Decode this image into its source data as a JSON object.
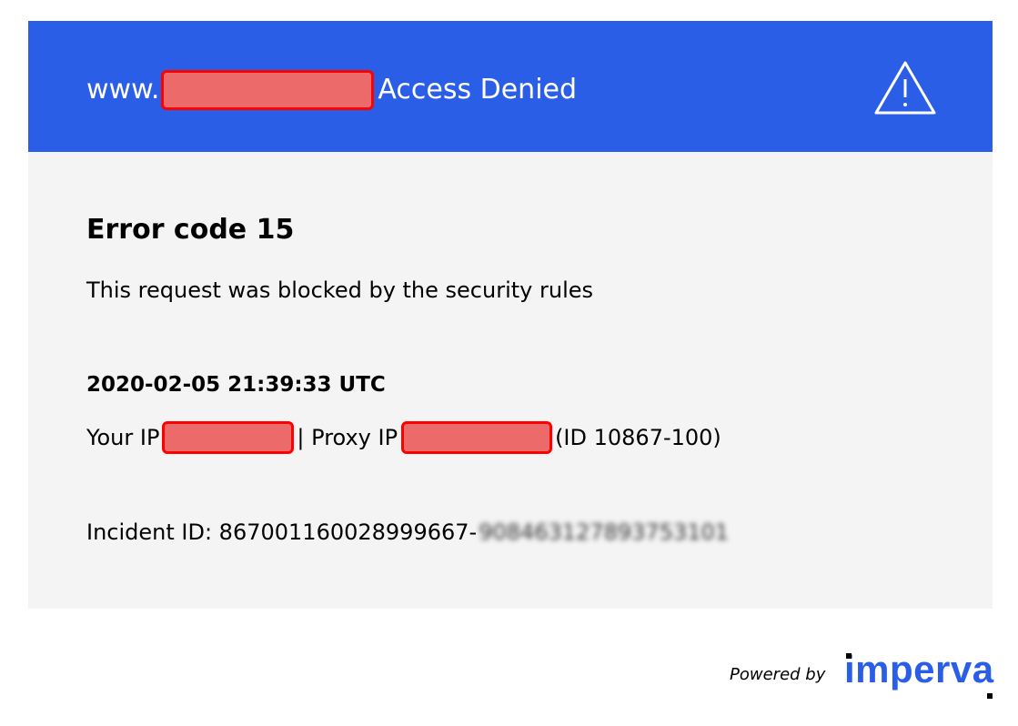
{
  "header": {
    "prefix": "www.",
    "title": "Access Denied",
    "icon": "warning-triangle-icon",
    "background_color": "#2a5ee6"
  },
  "error": {
    "code_title": "Error code 15",
    "message": "This request was blocked by the security rules"
  },
  "details": {
    "timestamp": "2020-02-05 21:39:33 UTC",
    "your_ip_label": "Your IP",
    "separator": "| Proxy IP",
    "id_text": "(ID 10867-100)",
    "incident_label": "Incident ID: 867001160028999667-",
    "incident_suffix_blurred": "908463127893753101"
  },
  "footer": {
    "powered_by": "Powered by",
    "logo_text": "imperva",
    "brand_color": "#2a5ee6"
  }
}
